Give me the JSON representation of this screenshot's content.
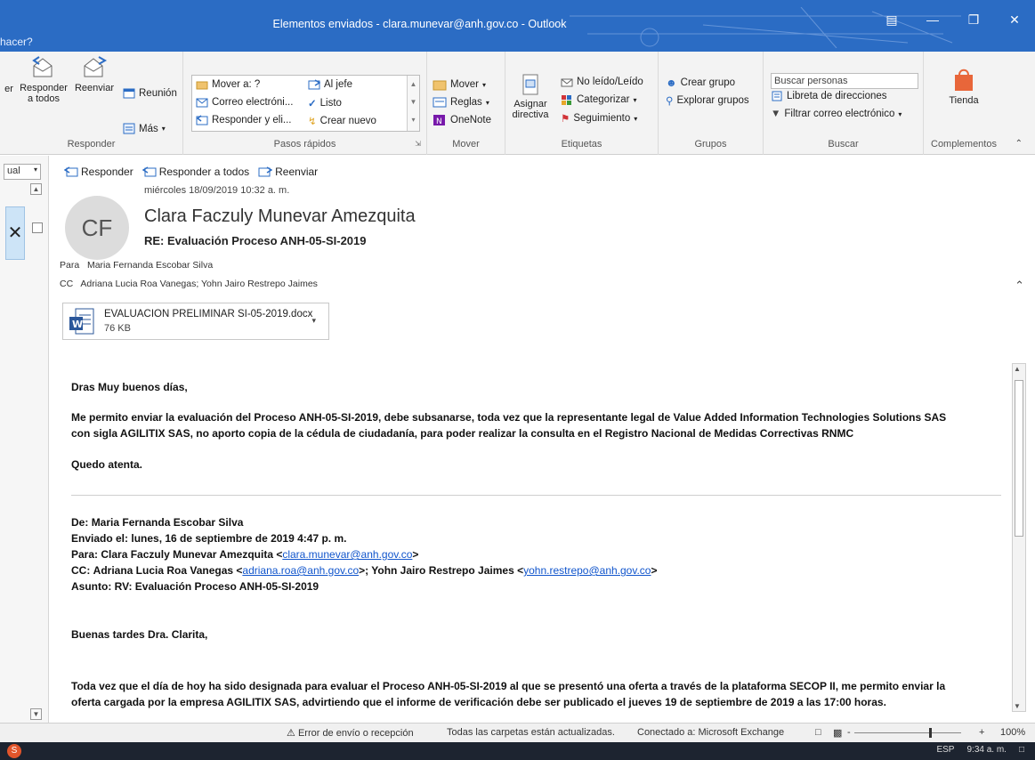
{
  "window": {
    "title": "Elementos enviados - clara.munevar@anh.gov.co  -  Outlook",
    "tell_me": "hacer?"
  },
  "ribbon": {
    "responder": {
      "reply_all": "Responder a todos",
      "forward": "Reenviar",
      "reply_partial": "er",
      "meeting": "Reunión",
      "more": "Más",
      "label": "Responder"
    },
    "quick_steps": {
      "items": [
        "Mover a: ?",
        "Correo electróni...",
        "Responder y eli...",
        "Al jefe",
        "Listo",
        "Crear nuevo"
      ],
      "label": "Pasos rápidos"
    },
    "mover": {
      "move": "Mover",
      "rules": "Reglas",
      "onenote": "OneNote",
      "label": "Mover"
    },
    "tags": {
      "assign_policy": "Asignar directiva",
      "unread_read": "No leído/Leído",
      "categorize": "Categorizar",
      "followup": "Seguimiento",
      "label": "Etiquetas"
    },
    "groups": {
      "create_group": "Crear grupo",
      "browse_groups": "Explorar grupos",
      "label": "Grupos"
    },
    "find": {
      "search_people": "Buscar personas",
      "address_book": "Libreta de direcciones",
      "filter_email": "Filtrar correo electrónico",
      "label": "Buscar"
    },
    "addins": {
      "store": "Tienda",
      "label": "Complementos"
    }
  },
  "left": {
    "view_selector": "ual"
  },
  "message": {
    "actions": [
      "Responder",
      "Responder a todos",
      "Reenviar"
    ],
    "datetime": "miércoles 18/09/2019 10:32 a. m.",
    "avatar_initials": "CF",
    "sender": "Clara Faczuly Munevar Amezquita",
    "subject": "RE: Evaluación Proceso ANH-05-SI-2019",
    "to_label": "Para",
    "to": "Maria Fernanda Escobar Silva",
    "cc_label": "CC",
    "cc": "Adriana Lucia Roa Vanegas; Yohn Jairo Restrepo Jaimes",
    "attachment": {
      "name": "EVALUACION PRELIMINAR SI-05-2019.docx",
      "size": "76 KB"
    }
  },
  "body": {
    "greeting": "Dras Muy buenos días,",
    "para1_line1": "Me permito enviar la evaluación del Proceso ANH-05-SI-2019,  debe subsanarse, toda vez que la representante legal de  Value Added Information Technologies Solutions SAS",
    "para1_line2": "con sigla AGILITIX SAS, no aporto copia de la cédula de ciudadanía, para poder realizar la consulta en el Registro Nacional de Medidas Correctivas RNMC",
    "closing": "Quedo atenta.",
    "fwd_from_label": "De:",
    "fwd_from": "Maria Fernanda Escobar Silva",
    "fwd_sent_label": "Enviado el:",
    "fwd_sent": "lunes, 16 de septiembre de 2019 4:47 p. m.",
    "fwd_to_label": "Para:",
    "fwd_to_name": "Clara Faczuly Munevar Amezquita <",
    "fwd_to_email": "clara.munevar@anh.gov.co",
    "fwd_to_close": ">",
    "fwd_cc_label": "CC:",
    "fwd_cc_name1": "Adriana Lucia Roa Vanegas <",
    "fwd_cc_email1": "adriana.roa@anh.gov.co",
    "fwd_cc_mid": ">; Yohn Jairo Restrepo Jaimes <",
    "fwd_cc_email2": "yohn.restrepo@anh.gov.co",
    "fwd_cc_close": ">",
    "fwd_subject_label": "Asunto:",
    "fwd_subject": "RV: Evaluación Proceso ANH-05-SI-2019",
    "fwd_greeting": "Buenas tardes Dra. Clarita,",
    "fwd_para_line1": "Toda vez que el día de hoy ha sido designada para evaluar el Proceso ANH-05-SI-2019 al que se presentó una oferta a través de la plataforma SECOP II,  me permito enviar la",
    "fwd_para_line2": "oferta cargada por la empresa AGILITIX SAS, advirtiendo que el informe de verificación debe ser publicado el jueves 19 de septiembre de 2019 a las 17:00 horas."
  },
  "status": {
    "error": "Error de envío o recepción",
    "folders": "Todas las carpetas están actualizadas.",
    "connected": "Conectado a: Microsoft Exchange",
    "zoom": "100%",
    "zoom_minus": "-",
    "zoom_plus": "+",
    "zoom_fraction": 0.7
  },
  "taskbar": {
    "lang": "ESP",
    "time": "9:34 a. m."
  }
}
